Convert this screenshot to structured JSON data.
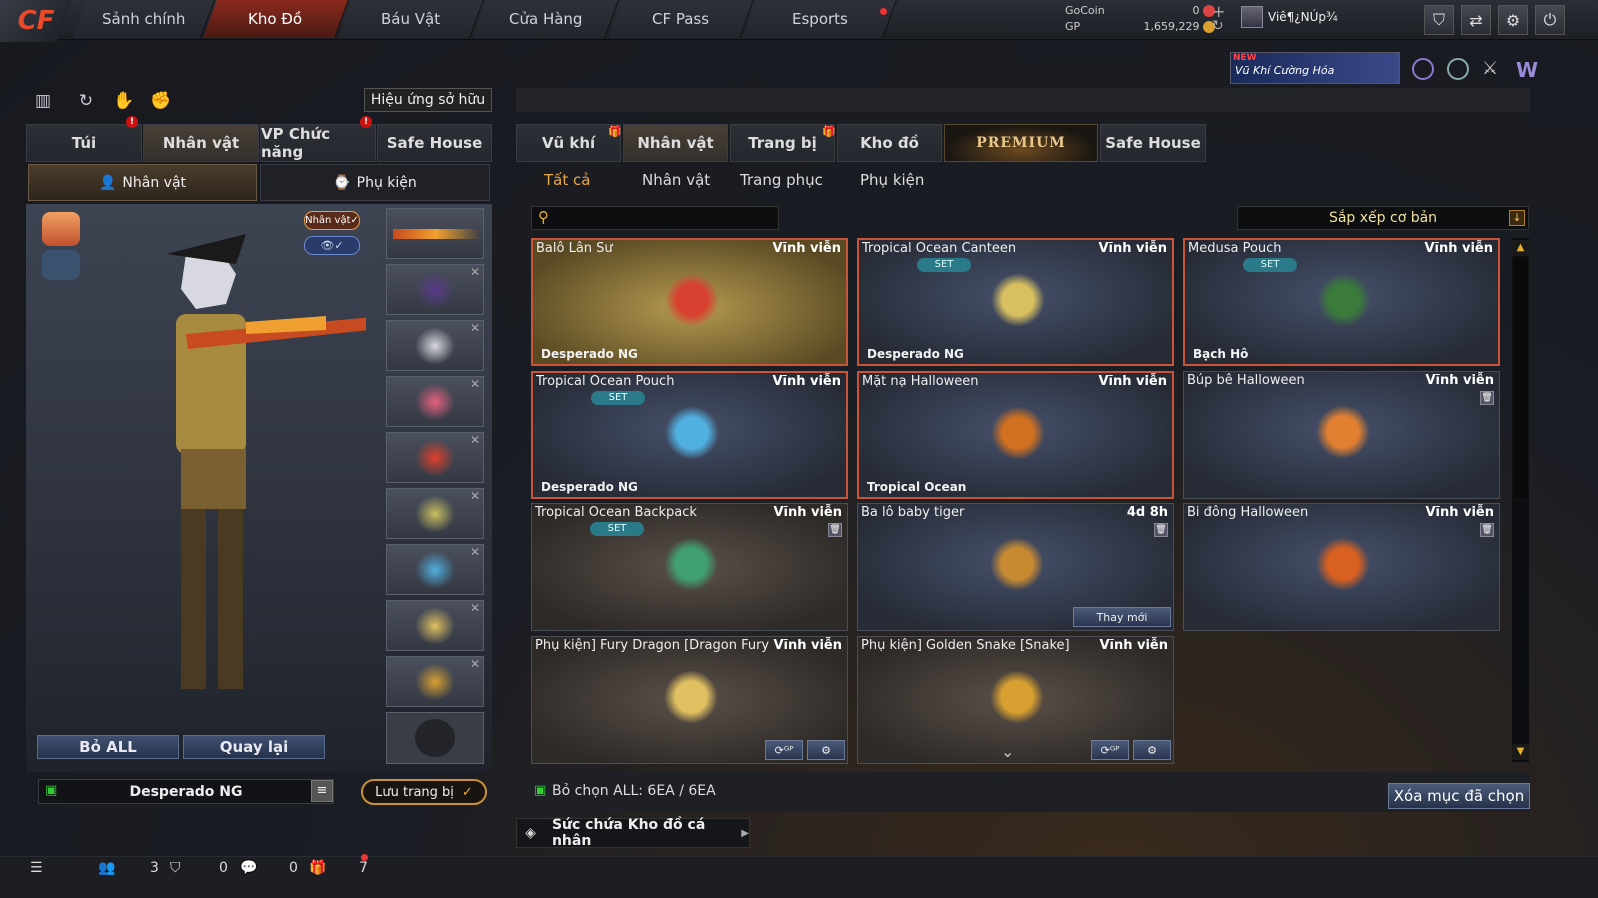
{
  "topnav": {
    "logo": "CF",
    "tabs": [
      "Sảnh chính",
      "Kho Đồ",
      "Báu Vật",
      "Cửa Hàng",
      "CF Pass",
      "Esports"
    ],
    "active_tab": "Kho Đồ"
  },
  "currency": {
    "gocoin_label": "GoCoin",
    "gocoin_value": "0",
    "gp_label": "GP",
    "gp_value": "1,659,229"
  },
  "user": {
    "name": "Viê¶¿NÚp¾"
  },
  "promo": {
    "badge": "NEW",
    "text": "Vũ Khí Cường Hóa"
  },
  "left": {
    "effects_button": "Hiệu ứng sở hữu",
    "tabs": [
      "Túi",
      "Nhân vật",
      "VP Chức năng",
      "Safe House"
    ],
    "active_tab": "Nhân vật",
    "subtabs": [
      "Nhân vật",
      "Phụ kiện"
    ],
    "active_subtab": "Nhân vật",
    "character_tag": "Nhân vật✓",
    "remove_all": "Bỏ ALL",
    "back": "Quay lại",
    "preset_name": "Desperado NG",
    "save_button": "Lưu trang bị"
  },
  "right": {
    "tabs": [
      "Vũ khí",
      "Nhân vật",
      "Trang bị",
      "Kho đồ",
      "PREMIUM",
      "Safe House"
    ],
    "active_tab": "Nhân vật",
    "filters": [
      "Tất cả",
      "Nhân vật",
      "Trang phục",
      "Phụ kiện"
    ],
    "active_filter": "Tất cả",
    "search_placeholder": "",
    "sort": "Sắp xếp cơ bản",
    "items": [
      {
        "name": "Balô Lân Sư",
        "duration": "Vĩnh viễn",
        "set": false,
        "bottom": "Desperado NG",
        "selected": true,
        "style": "gold"
      },
      {
        "name": "Tropical Ocean Canteen",
        "duration": "Vĩnh viễn",
        "set": true,
        "bottom": "Desperado NG",
        "selected": true,
        "style": "blue"
      },
      {
        "name": "Medusa Pouch",
        "duration": "Vĩnh viễn",
        "set": true,
        "bottom": "Bạch Hô",
        "selected": true,
        "style": "blue"
      },
      {
        "name": "Tropical Ocean Pouch",
        "duration": "Vĩnh viễn",
        "set": true,
        "bottom": "Desperado NG",
        "selected": true,
        "style": "blue"
      },
      {
        "name": "Mặt nạ Halloween",
        "duration": "Vĩnh viễn",
        "set": false,
        "bottom": "Tropical Ocean",
        "selected": true,
        "style": "blue"
      },
      {
        "name": "Búp bê Halloween",
        "duration": "Vĩnh viễn",
        "set": false,
        "bottom": "",
        "selected": false,
        "trash": true,
        "style": "blue"
      },
      {
        "name": "Tropical Ocean Backpack",
        "duration": "Vĩnh viễn",
        "set": true,
        "bottom": "",
        "selected": false,
        "trash": true,
        "style": "brown"
      },
      {
        "name": "Ba lô baby tiger",
        "duration": "4d 8h",
        "set": false,
        "bottom": "",
        "selected": false,
        "trash": true,
        "renew": "Thay mới",
        "style": "blue"
      },
      {
        "name": "Bi đông Halloween",
        "duration": "Vĩnh viễn",
        "set": false,
        "bottom": "",
        "selected": false,
        "trash": true,
        "style": "blue"
      },
      {
        "name": "Phụ kiện] Fury Dragon [Dragon Fury",
        "duration": "Vĩnh viễn",
        "set": false,
        "bottom": "",
        "selected": false,
        "style": "brown"
      },
      {
        "name": "Phụ kiện] Golden Snake [Snake]",
        "duration": "Vĩnh viễn",
        "set": false,
        "bottom": "",
        "selected": false,
        "style": "brown"
      }
    ],
    "set_label": "SET",
    "select_all": "Bỏ chọn ALL: 6EA / 6EA",
    "capacity": "Sức chứa Kho đồ cá nhân",
    "delete_selected": "Xóa mục đã chọn"
  },
  "status": {
    "friends": "3",
    "clan": "0",
    "messages": "0",
    "gifts": "7"
  },
  "colors": {
    "accent": "#c8553a",
    "gold": "#e6a94a",
    "nav_active": "#8a2a1c"
  }
}
